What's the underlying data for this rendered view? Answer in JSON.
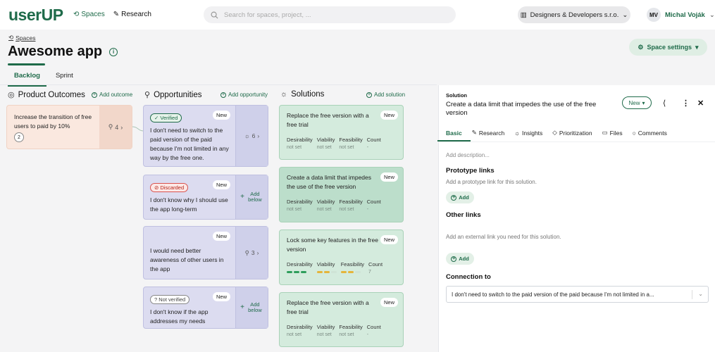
{
  "app": {
    "logo": "userUP",
    "nav": [
      {
        "label": "Spaces",
        "active": true
      },
      {
        "label": "Research",
        "active": false
      }
    ],
    "search_placeholder": "Search for spaces, project, ...",
    "org": "Designers & Developers s.r.o.",
    "user_initials": "MV",
    "user_name": "Michal Voják"
  },
  "header": {
    "breadcrumb": "Spaces",
    "title": "Awesome app",
    "space_settings": "Space settings",
    "tabs": [
      {
        "label": "Backlog",
        "active": true
      },
      {
        "label": "Sprint",
        "active": false
      }
    ]
  },
  "columns": {
    "outcomes": {
      "title": "Product Outcomes",
      "add": "Add outcome"
    },
    "opportunities": {
      "title": "Opportunities",
      "add": "Add opportunity"
    },
    "solutions": {
      "title": "Solutions",
      "add": "Add solution"
    }
  },
  "outcome": {
    "text": "Increase the transition of free users to paid by 10%",
    "badge": "2",
    "count": "4"
  },
  "opportunities": [
    {
      "status": "Verified",
      "tag": "New",
      "text": "I don't need to switch to the paid version of the paid because I'm not limited in any way by the free one.",
      "count": "6",
      "add": ""
    },
    {
      "status": "Discarded",
      "tag": "New",
      "text": "I don't know why I should use the app long-term",
      "count": "",
      "add": "Add below"
    },
    {
      "status": "",
      "tag": "New",
      "text": "I would need better awareness of other users in the app",
      "count": "3",
      "add": ""
    },
    {
      "status": "Not verified",
      "tag": "New",
      "text": "I don't know if the app addresses my needs",
      "count": "",
      "add": "Add below"
    }
  ],
  "solution_metric_labels": [
    "Desirability",
    "Viability",
    "Feasibility",
    "Count"
  ],
  "solutions": [
    {
      "title": "Replace the free version with a free trial",
      "tag": "New",
      "values": [
        "not set",
        "not set",
        "not set",
        "-"
      ]
    },
    {
      "title": "Create a data limit that impedes the use of the free version",
      "tag": "New",
      "values": [
        "not set",
        "not set",
        "not set",
        "-"
      ]
    },
    {
      "title": "Lock some key features in the free version",
      "tag": "New",
      "values": [
        "",
        "",
        "",
        "7"
      ],
      "bars": [
        [
          "#2e9e5b",
          "#2e9e5b",
          "#2e9e5b"
        ],
        [
          "#e5b53a",
          "#e5b53a",
          "#cfe3d6"
        ],
        [
          "#e5b53a",
          "#e5b53a",
          "#cfe3d6"
        ]
      ]
    },
    {
      "title": "Replace the free version with a free trial",
      "tag": "New",
      "values": [
        "not set",
        "not set",
        "not set",
        "-"
      ]
    }
  ],
  "panel": {
    "label": "Solution",
    "title": "Create a data limit that impedes the use of the free version",
    "status": "New",
    "tabs": [
      {
        "label": "Basic",
        "active": true
      },
      {
        "label": "Research"
      },
      {
        "label": "Insights"
      },
      {
        "label": "Prioritization"
      },
      {
        "label": "Files"
      },
      {
        "label": "Comments"
      }
    ],
    "description_placeholder": "Add description...",
    "prototype_title": "Prototype links",
    "prototype_hint": "Add a prototype link for this solution.",
    "other_title": "Other links",
    "other_hint": "Add an external link you need for this solution.",
    "add_label": "Add",
    "connection_title": "Connection to",
    "connection_value": "I don't need to switch to the paid version of the paid because I'm not limited in a..."
  }
}
